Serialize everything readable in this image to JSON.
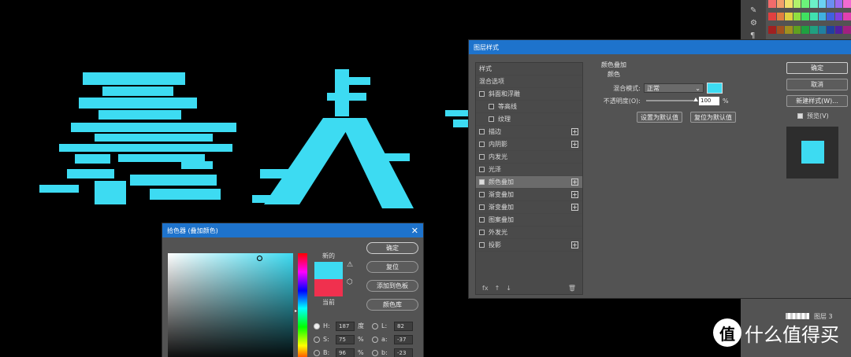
{
  "colors": {
    "accent": "#3DDBF2",
    "current": "#F0304E",
    "title_bar": "#1E73CC",
    "canvas_bg": "#000000"
  },
  "canvas": {
    "art_text": "愚人"
  },
  "layer_style_dialog": {
    "title": "图层样式",
    "list_header": "样式",
    "items": [
      {
        "label": "混合选项",
        "checkbox": false,
        "plus": false,
        "indent": false,
        "selected": false,
        "header": true
      },
      {
        "label": "斜面和浮雕",
        "checkbox": true,
        "checked": false,
        "plus": false,
        "indent": false,
        "selected": false
      },
      {
        "label": "等高线",
        "checkbox": true,
        "checked": false,
        "plus": false,
        "indent": true,
        "selected": false
      },
      {
        "label": "纹理",
        "checkbox": true,
        "checked": false,
        "plus": false,
        "indent": true,
        "selected": false
      },
      {
        "label": "描边",
        "checkbox": true,
        "checked": false,
        "plus": true,
        "indent": false,
        "selected": false
      },
      {
        "label": "内阴影",
        "checkbox": true,
        "checked": false,
        "plus": true,
        "indent": false,
        "selected": false
      },
      {
        "label": "内发光",
        "checkbox": true,
        "checked": false,
        "plus": false,
        "indent": false,
        "selected": false
      },
      {
        "label": "光泽",
        "checkbox": true,
        "checked": false,
        "plus": false,
        "indent": false,
        "selected": false
      },
      {
        "label": "颜色叠加",
        "checkbox": true,
        "checked": true,
        "plus": true,
        "indent": false,
        "selected": true
      },
      {
        "label": "渐变叠加",
        "checkbox": true,
        "checked": false,
        "plus": true,
        "indent": false,
        "selected": false
      },
      {
        "label": "渐变叠加",
        "checkbox": true,
        "checked": false,
        "plus": true,
        "indent": false,
        "selected": false
      },
      {
        "label": "图案叠加",
        "checkbox": true,
        "checked": false,
        "plus": false,
        "indent": false,
        "selected": false
      },
      {
        "label": "外发光",
        "checkbox": true,
        "checked": false,
        "plus": false,
        "indent": false,
        "selected": false
      },
      {
        "label": "投影",
        "checkbox": true,
        "checked": false,
        "plus": true,
        "indent": false,
        "selected": false
      }
    ],
    "footer_icons": [
      "fx",
      "↑",
      "↓",
      "🗑"
    ],
    "section_title": "颜色叠加",
    "sub_title": "颜色",
    "blend_mode_label": "混合模式:",
    "blend_mode_value": "正常",
    "opacity_label": "不透明度(O):",
    "opacity_value": "100",
    "opacity_unit": "%",
    "opacity_level": 1.0,
    "set_default": "设置为默认值",
    "reset_default": "复位为默认值",
    "ok": "确定",
    "cancel": "取消",
    "new_style": "新建样式(W)...",
    "preview_label": "预览(V)"
  },
  "color_picker": {
    "title": "拾色器 (叠加颜色)",
    "new_label": "新的",
    "current_label": "当前",
    "ok": "确定",
    "reset": "复位",
    "add_swatch": "添加到色板",
    "color_library": "颜色库",
    "values": [
      {
        "radio_left": true,
        "label": "H:",
        "value": "187",
        "unit": "度",
        "label2": "L:",
        "value2": "82"
      },
      {
        "radio_left": false,
        "label": "S:",
        "value": "75",
        "unit": "%",
        "label2": "a:",
        "value2": "-37"
      },
      {
        "radio_left": false,
        "label": "B:",
        "value": "96",
        "unit": "%",
        "label2": "b:",
        "value2": "-23"
      }
    ]
  },
  "layers_panel": {
    "layer_name": "图层 3"
  },
  "watermark": {
    "logo": "值",
    "text": "什么值得买"
  }
}
